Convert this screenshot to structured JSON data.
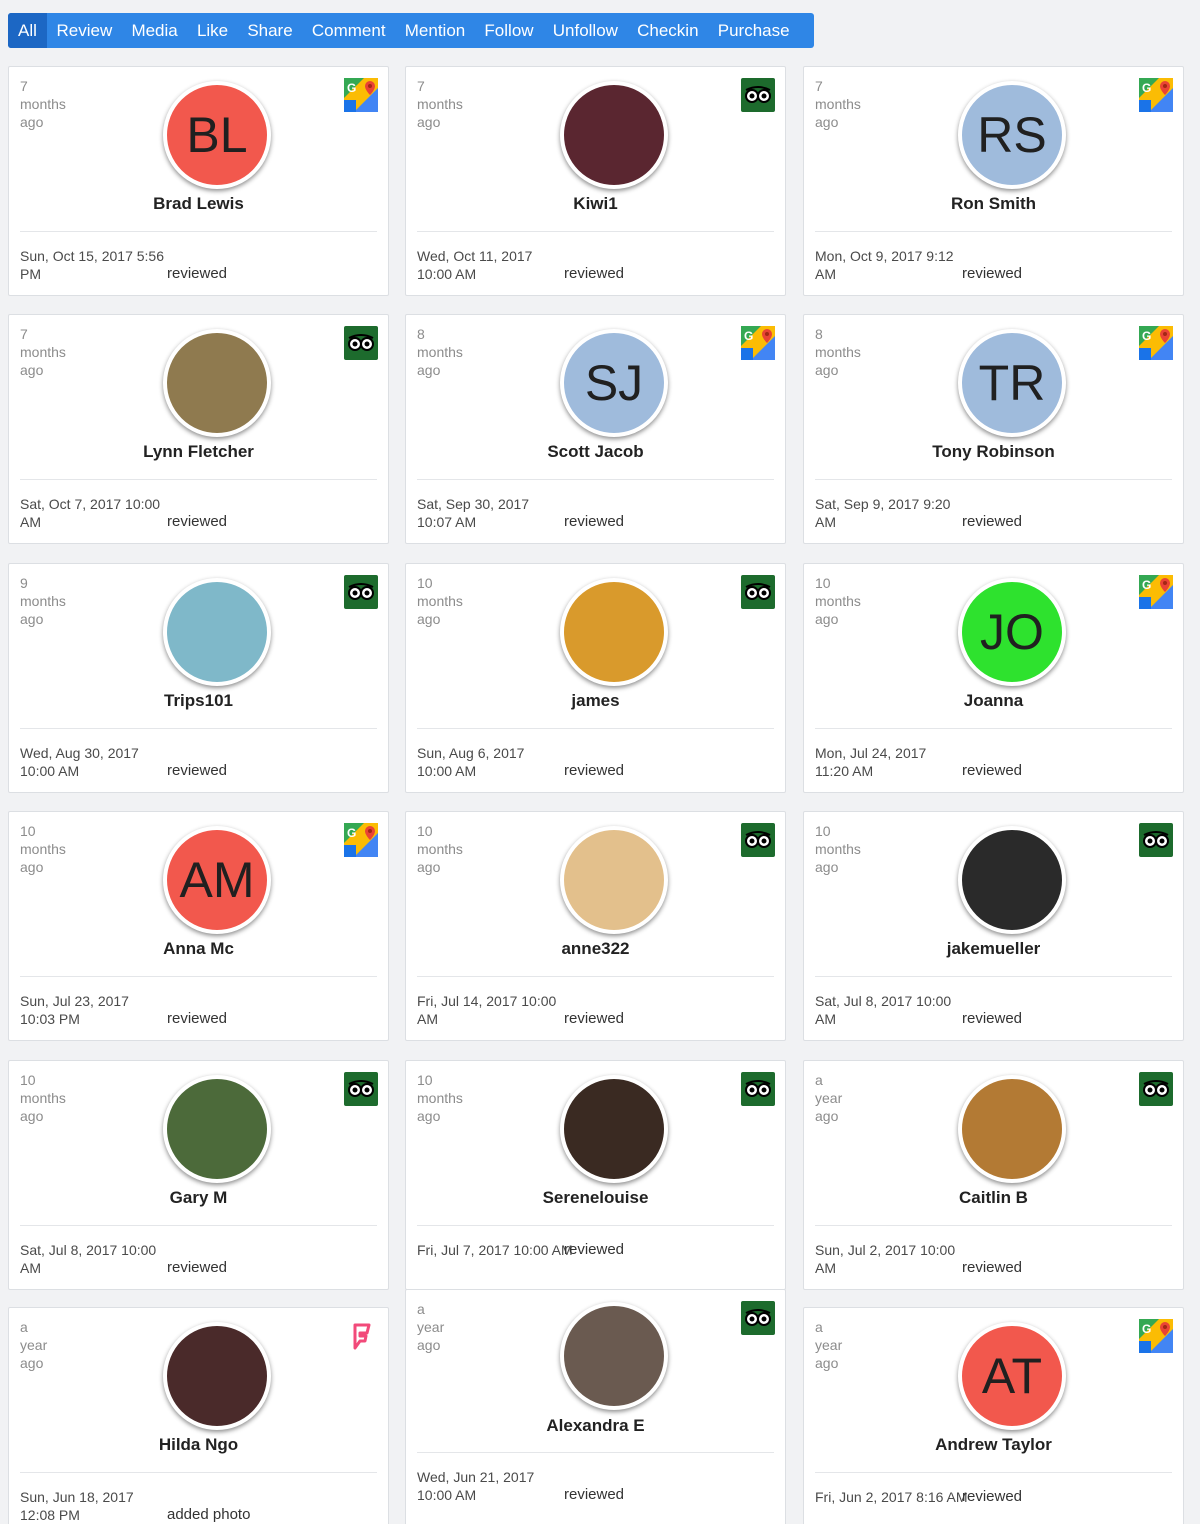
{
  "tabs": [
    "All",
    "Review",
    "Media",
    "Like",
    "Share",
    "Comment",
    "Mention",
    "Follow",
    "Unfollow",
    "Checkin",
    "Purchase"
  ],
  "cards": [
    {
      "ago": "7 months ago",
      "initials": "BL",
      "avatar_color": "#f2584d",
      "name": "Brad Lewis",
      "date": "Sun, Oct 15, 2017 5:56 PM",
      "action": "reviewed",
      "source": "google-maps-icon"
    },
    {
      "ago": "7 months ago",
      "initials": "",
      "avatar_color": "#5a2630",
      "name": "Kiwi1",
      "date": "Wed, Oct 11, 2017 10:00 AM",
      "action": "reviewed",
      "source": "tripadvisor-icon"
    },
    {
      "ago": "7 months ago",
      "initials": "RS",
      "avatar_color": "#9fbbdc",
      "name": "Ron Smith",
      "date": "Mon, Oct 9, 2017 9:12 AM",
      "action": "reviewed",
      "source": "google-maps-icon"
    },
    {
      "ago": "7 months ago",
      "initials": "",
      "avatar_color": "#8f7a4f",
      "name": "Lynn Fletcher",
      "date": "Sat, Oct 7, 2017 10:00 AM",
      "action": "reviewed",
      "source": "tripadvisor-icon"
    },
    {
      "ago": "8 months ago",
      "initials": "SJ",
      "avatar_color": "#9fbbdc",
      "name": "Scott Jacob",
      "date": "Sat, Sep 30, 2017 10:07 AM",
      "action": "reviewed",
      "source": "google-maps-icon"
    },
    {
      "ago": "8 months ago",
      "initials": "TR",
      "avatar_color": "#9fbbdc",
      "name": "Tony Robinson",
      "date": "Sat, Sep 9, 2017 9:20 AM",
      "action": "reviewed",
      "source": "google-maps-icon"
    },
    {
      "ago": "9 months ago",
      "initials": "",
      "avatar_color": "#7fb8c9",
      "name": "Trips101",
      "date": "Wed, Aug 30, 2017 10:00 AM",
      "action": "reviewed",
      "source": "tripadvisor-icon"
    },
    {
      "ago": "10 months ago",
      "initials": "",
      "avatar_color": "#d99a2c",
      "name": "james",
      "date": "Sun, Aug 6, 2017 10:00 AM",
      "action": "reviewed",
      "source": "tripadvisor-icon"
    },
    {
      "ago": "10 months ago",
      "initials": "JO",
      "avatar_color": "#2ee22e",
      "name": "Joanna",
      "date": "Mon, Jul 24, 2017 11:20 AM",
      "action": "reviewed",
      "source": "google-maps-icon"
    },
    {
      "ago": "10 months ago",
      "initials": "AM",
      "avatar_color": "#f2584d",
      "name": "Anna Mc",
      "date": "Sun, Jul 23, 2017 10:03 PM",
      "action": "reviewed",
      "source": "google-maps-icon"
    },
    {
      "ago": "10 months ago",
      "initials": "",
      "avatar_color": "#e3c08c",
      "name": "anne322",
      "date": "Fri, Jul 14, 2017 10:00 AM",
      "action": "reviewed",
      "source": "tripadvisor-icon"
    },
    {
      "ago": "10 months ago",
      "initials": "",
      "avatar_color": "#2a2a2a",
      "name": "jakemueller",
      "date": "Sat, Jul 8, 2017 10:00 AM",
      "action": "reviewed",
      "source": "tripadvisor-icon"
    },
    {
      "ago": "10 months ago",
      "initials": "",
      "avatar_color": "#4c6a3a",
      "name": "Gary M",
      "date": "Sat, Jul 8, 2017 10:00 AM",
      "action": "reviewed",
      "source": "tripadvisor-icon"
    },
    {
      "ago": "10 months ago",
      "initials": "",
      "avatar_color": "#3a2a22",
      "name": "Serenelouise",
      "date": "Fri, Jul 7, 2017 10:00 AM",
      "action": "reviewed",
      "source": "tripadvisor-icon",
      "inline": true
    },
    {
      "ago": "a year ago",
      "initials": "",
      "avatar_color": "#b37a34",
      "name": "Caitlin B",
      "date": "Sun, Jul 2, 2017 10:00 AM",
      "action": "reviewed",
      "source": "tripadvisor-icon"
    },
    {
      "ago": "a year ago",
      "initials": "",
      "avatar_color": "#4a2a2a",
      "name": "Hilda Ngo",
      "date": "Sun, Jun 18, 2017 12:08 PM",
      "action": "added photo",
      "source": "foursquare-icon"
    },
    {
      "ago": "a year ago",
      "initials": "",
      "avatar_color": "#6a5a50",
      "name": "Alexandra E",
      "date": "Wed, Jun 21, 2017 10:00 AM",
      "action": "reviewed",
      "source": "tripadvisor-icon"
    },
    {
      "ago": "a year ago",
      "initials": "AT",
      "avatar_color": "#f2584d",
      "name": "Andrew Taylor",
      "date": "Fri, Jun 2, 2017 8:16 AM",
      "action": "reviewed",
      "source": "google-maps-icon",
      "inline": true
    }
  ]
}
